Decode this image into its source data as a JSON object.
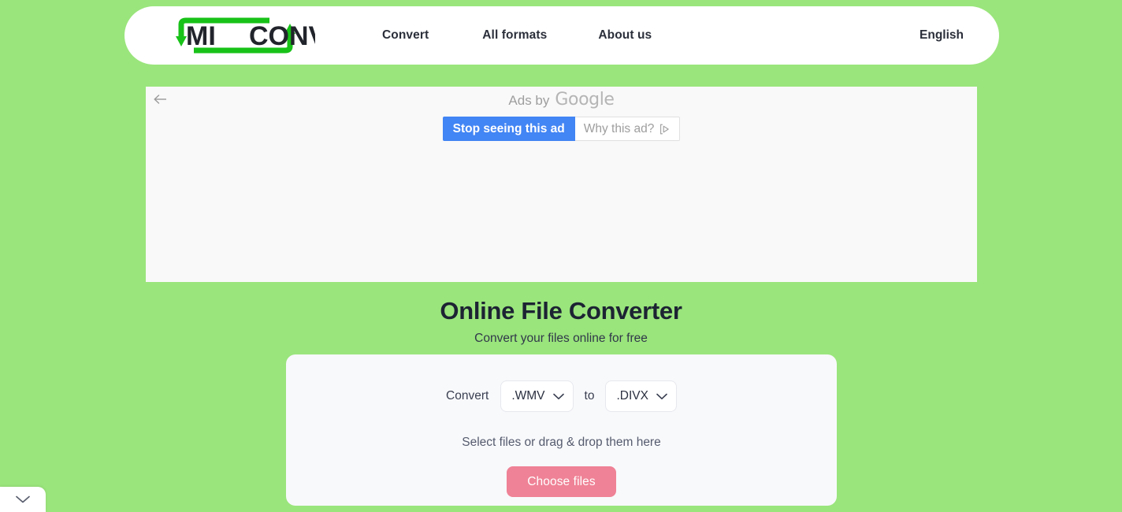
{
  "header": {
    "logo": {
      "text_primary": "MI",
      "text_secondary": "CONV",
      "icon": "recycle-arrows-icon",
      "accent_color": "#18c218"
    },
    "nav": [
      {
        "label": "Convert"
      },
      {
        "label": "All formats"
      },
      {
        "label": "About us"
      }
    ],
    "language": "English"
  },
  "ad": {
    "back_icon": "back-arrow-icon",
    "byline_prefix": "Ads by",
    "byline_brand": "Google",
    "stop_button": "Stop seeing this ad",
    "why_button": "Why this ad?",
    "why_icon": "adchoices-icon",
    "stop_button_color": "#4285f4"
  },
  "hero": {
    "title": "Online File Converter",
    "subtitle": "Convert your files online for free"
  },
  "converter": {
    "convert_label": "Convert",
    "to_label": "to",
    "source_format": ".WMV",
    "target_format": ".DIVX",
    "chevron_icon": "chevron-down-icon",
    "drop_text": "Select files or drag & drop them here",
    "choose_button": "Choose files",
    "choose_button_color": "#ef8296"
  },
  "bottom_tab": {
    "icon": "chevron-down-icon"
  },
  "theme": {
    "background": "#9ae57c",
    "card_background": "#f8f9fb",
    "text_dark": "#1d2333"
  }
}
